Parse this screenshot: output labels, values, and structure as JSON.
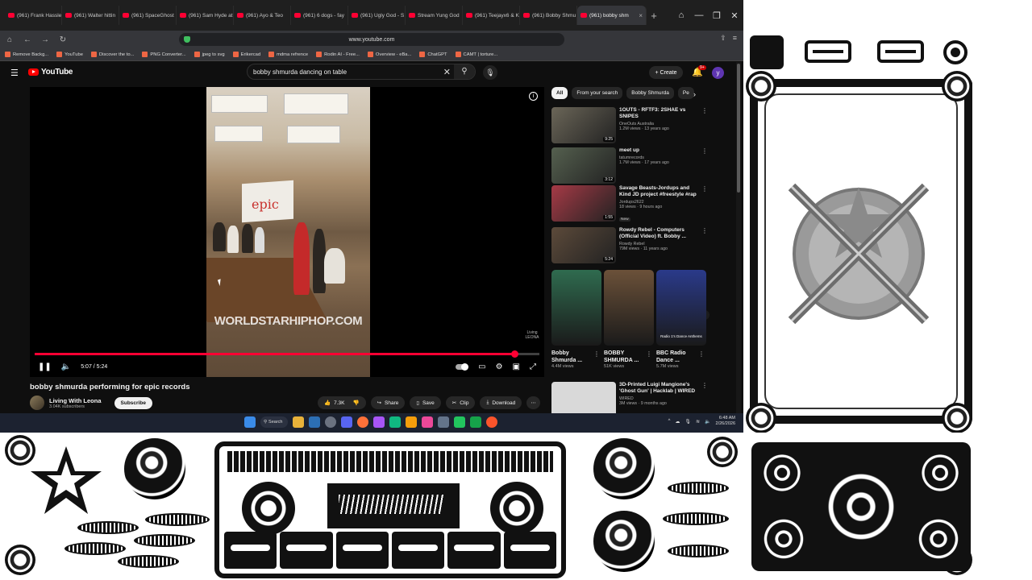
{
  "browser": {
    "tabs": [
      {
        "label": "(961) Frank Hassle"
      },
      {
        "label": "(961) Walter hittin"
      },
      {
        "label": "(961) SpaceGhost"
      },
      {
        "label": "(961) Sam Hyde at"
      },
      {
        "label": "(961) Ayo & Teo"
      },
      {
        "label": "(961) 6 dogs - fay"
      },
      {
        "label": "(961) Ugly God - S"
      },
      {
        "label": "Stream Yung God"
      },
      {
        "label": "(961) Teejayx6 & K"
      },
      {
        "label": "(961) Bobby Shmu"
      },
      {
        "label": "(961) bobby shm",
        "active": true
      }
    ],
    "new_tab": "+",
    "window_controls": [
      "⌂",
      "—",
      "❐",
      "✕"
    ],
    "url": "www.youtube.com",
    "bookmarks": [
      "Remove Backg...",
      "YouTube",
      "Discover the to...",
      "PNG Converter...",
      "jpeg to svg",
      "Erikercad",
      "mdma refrence",
      "Rodin AI - Free...",
      "Overview - eBa...",
      "ChatGPT",
      "CAMT | torture..."
    ]
  },
  "youtube": {
    "logo": "YouTube",
    "search_query": "bobby shmurda dancing on table",
    "create_label": "Create",
    "notif_count": "9+",
    "avatar_letter": "y",
    "player": {
      "watermark": "WORLDSTARHIPHOP.COM",
      "sign_text": "epic",
      "time": "5:07 / 5:24",
      "progress": 0.95,
      "channel_watermark": "Living LEONA"
    },
    "video_title": "bobby shmurda performing for epic records",
    "channel": {
      "name": "Living With Leona",
      "subs": "3.04K subscribers",
      "subscribe": "Subscribe"
    },
    "actions": {
      "like": "7.3K",
      "share": "Share",
      "save": "Save",
      "clip": "Clip",
      "download": "Download",
      "more": "⋯"
    },
    "chips": [
      "All",
      "From your search",
      "Bobby Shmurda",
      "Pe"
    ],
    "recommendations": [
      {
        "title": "1OUTS - RFTF3: 2SHAE vs SNIPES",
        "channel": "OneOuts Australia",
        "views": "1.2M views · 13 years ago",
        "duration": "9:25",
        "color": "#6b6658"
      },
      {
        "title": "meet up",
        "channel": "tatumrecords",
        "views": "1.7M views · 17 years ago",
        "duration": "3:12",
        "color": "#55604f"
      },
      {
        "title": "Savage Beasts-Jordups and Kind JD project #freestyle #rap",
        "channel": "Jordups2622",
        "views": "18 views · 9 hours ago",
        "badge": "New",
        "duration": "1:55",
        "color": "#a63a46"
      },
      {
        "title": "Rowdy Rebel - Computers (Official Video) ft. Bobby ...",
        "channel": "Rowdy Rebel",
        "views": "79M views · 11 years ago",
        "duration": "5:24",
        "color": "#5c4a3a"
      }
    ],
    "shorts": [
      {
        "title": "Bobby Shmurda ...",
        "views": "4.4M views",
        "color": "#2f6b4f"
      },
      {
        "title": "BOBBY SHMURDA ...",
        "views": "51K views",
        "color": "#6b5139"
      },
      {
        "title": "BBC Radio Dance ...",
        "views": "5.7M views",
        "color": "#2a3a8a",
        "caption": "Radio 1's Dance Anthems"
      }
    ],
    "last_rec": {
      "title": "3D-Printed Luigi Mangione's 'Ghost Gun' | Hacklab | WIRED",
      "channel": "WIRED",
      "views": "3M views · 9 months ago",
      "color": "#d9d9d9"
    }
  },
  "taskbar": {
    "search": "Search",
    "time": "6:48 AM",
    "date": "2/26/2026"
  }
}
